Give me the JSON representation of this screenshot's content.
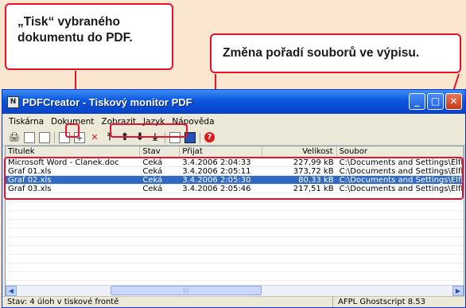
{
  "callouts": {
    "tisk_line1": "„Tisk“ vybraného",
    "tisk_line2": "dokumentu do PDF.",
    "order": "Změna pořadí souborů ve výpisu."
  },
  "window": {
    "title": "PDFCreator - Tiskový monitor PDF",
    "buttons": {
      "minimize": "_",
      "maximize": "□",
      "close": "✕"
    }
  },
  "menu": [
    "Tiskárna",
    "Dokument",
    "Zobrazit",
    "Jazyk",
    "Nápověda"
  ],
  "table": {
    "columns": [
      "Titulek",
      "Stav",
      "Přijat",
      "Velikost",
      "Soubor"
    ],
    "rows": [
      {
        "title": "Microsoft Word - Clanek.doc",
        "status": "Čeká",
        "received": "3.4.2006 2:04:33",
        "size": "227,99 kB",
        "file": "C:\\Documents and Settings\\Elfka"
      },
      {
        "title": "Graf 01.xls",
        "status": "Čeká",
        "received": "3.4.2006 2:05:11",
        "size": "373,72 kB",
        "file": "C:\\Documents and Settings\\Elfka"
      },
      {
        "title": "Graf 02.xls",
        "status": "Čeká",
        "received": "3.4.2006 2:05:30",
        "size": "80,33 kB",
        "file": "C:\\Documents and Settings\\Elfka"
      },
      {
        "title": "Graf 03.xls",
        "status": "Čeká",
        "received": "3.4.2006 2:05:46",
        "size": "217,51 kB",
        "file": "C:\\Documents and Settings\\Elfka"
      }
    ],
    "selected_index": 2
  },
  "status": {
    "left": "Stav: 4 úloh v tiskové frontě",
    "right": "AFPL Ghostscript 8.53"
  },
  "colors": {
    "accent_red": "#e8102b",
    "selection": "#316ac5",
    "background": "#fbe6cf"
  }
}
